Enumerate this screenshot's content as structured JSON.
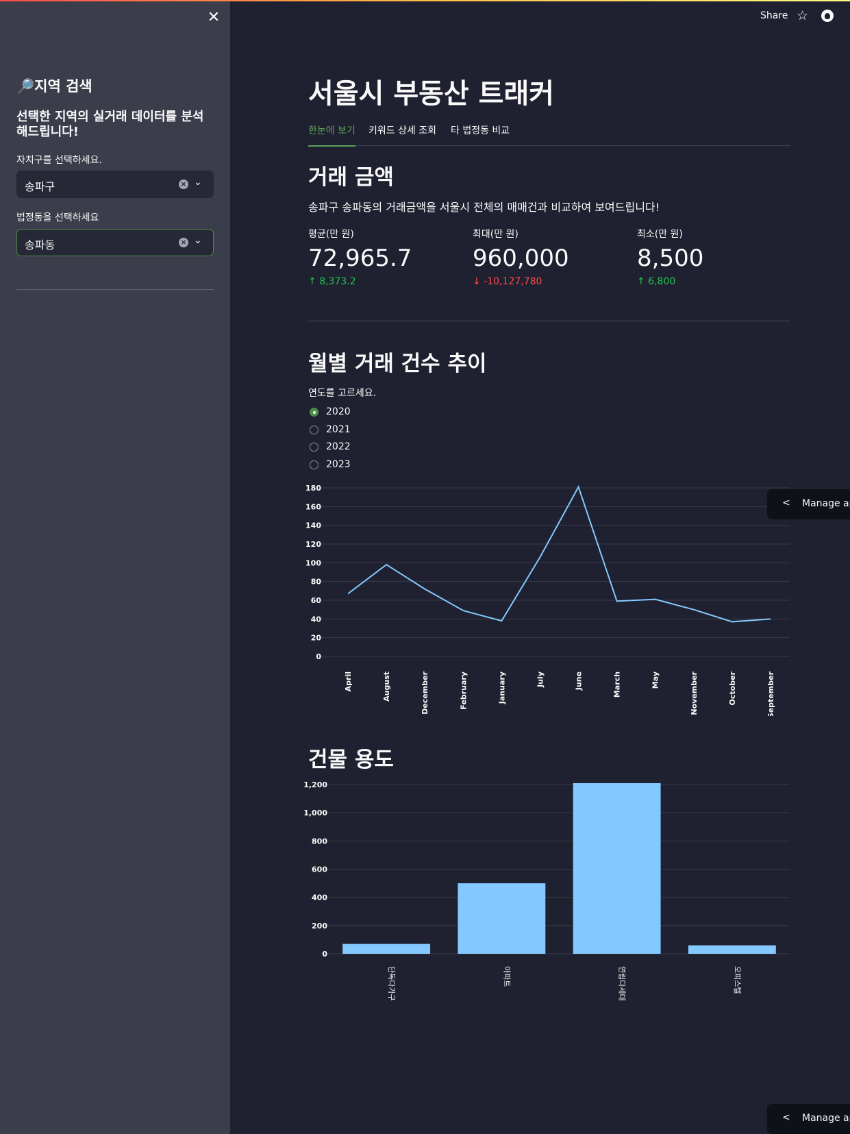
{
  "sidebar": {
    "title": "🔎지역 검색",
    "subtitle": "선택한 지역의 실거래 데이터를 분석해드립니다!",
    "district_label": "자치구를 선택하세요.",
    "district_value": "송파구",
    "dong_label": "법정동을 선택하세요",
    "dong_value": "송파동"
  },
  "header": {
    "share": "Share"
  },
  "page": {
    "title": "서울시 부동산 트래커",
    "tabs": [
      {
        "label": "한눈에 보기",
        "active": true
      },
      {
        "label": "키워드 상세 조회",
        "active": false
      },
      {
        "label": "타 법정동 비교",
        "active": false
      }
    ]
  },
  "amount": {
    "heading": "거래 금액",
    "description": "송파구 송파동의 거래금액을 서울시 전체의 매매건과 비교하여 보여드립니다!",
    "metrics": [
      {
        "label": "평균(만 원)",
        "value": "72,965.7",
        "delta": "8,373.2",
        "direction": "up"
      },
      {
        "label": "최대(만 원)",
        "value": "960,000",
        "delta": "-10,127,780",
        "direction": "down"
      },
      {
        "label": "최소(만 원)",
        "value": "8,500",
        "delta": "6,800",
        "direction": "up"
      }
    ]
  },
  "monthly": {
    "heading": "월별 거래 건수 추이",
    "radio_label": "연도를 고르세요.",
    "options": [
      "2020",
      "2021",
      "2022",
      "2023"
    ],
    "selected": "2020"
  },
  "building": {
    "heading": "건물 용도"
  },
  "manage_app": "Manage app",
  "colors": {
    "series": "#83c9ff",
    "accent": "#4b8c4b",
    "up": "#21c354",
    "down": "#ff4b4b"
  },
  "chart_data": [
    {
      "type": "line",
      "categories": [
        "April",
        "August",
        "December",
        "February",
        "January",
        "July",
        "June",
        "March",
        "May",
        "November",
        "October",
        "September"
      ],
      "values": [
        67,
        98,
        72,
        49,
        38,
        106,
        181,
        59,
        61,
        50,
        37,
        40
      ],
      "ylim": [
        0,
        180
      ],
      "yticks": [
        0,
        20,
        40,
        60,
        80,
        100,
        120,
        140,
        160,
        180
      ],
      "grid": true
    },
    {
      "type": "bar",
      "categories": [
        "단독다가구",
        "아파트",
        "연립다세대",
        "오피스텔"
      ],
      "values": [
        70,
        500,
        1210,
        60
      ],
      "ylim": [
        0,
        1200
      ],
      "yticks": [
        0,
        200,
        400,
        600,
        800,
        1000,
        1200
      ],
      "ytick_labels": [
        "0",
        "200",
        "400",
        "600",
        "800",
        "1,000",
        "1,200"
      ],
      "grid": true
    }
  ]
}
